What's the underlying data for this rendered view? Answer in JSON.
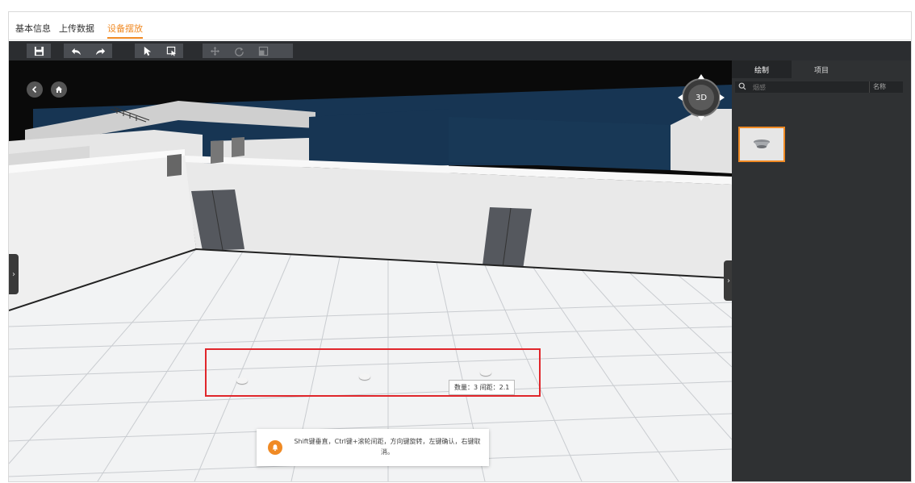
{
  "tabs": [
    {
      "label": "基本信息",
      "active": false
    },
    {
      "label": "上传数据",
      "active": false
    },
    {
      "label": "设备摆放",
      "active": true
    }
  ],
  "toolbar": {
    "buttons": [
      "save-icon",
      "undo-icon",
      "redo-icon",
      "pointer-icon",
      "box-select-icon",
      "move-icon",
      "rotate-icon",
      "scale-icon"
    ],
    "disabled": [
      "move-icon",
      "rotate-icon",
      "scale-icon"
    ]
  },
  "viewport": {
    "nav_label": "3D",
    "selection_info": "数量：3 间距：2.1",
    "hint_text": "Shift键垂直，Ctrl键+滚轮间距，方向键旋转，左键确认，右键取消。"
  },
  "panel": {
    "tabs": [
      {
        "label": "绘制",
        "active": true
      },
      {
        "label": "项目",
        "active": false
      }
    ],
    "search": {
      "placeholder": "烟感",
      "column_label": "名称"
    },
    "items": [
      {
        "name": "smoke-detector-icon",
        "selected": true
      }
    ]
  },
  "colors": {
    "accent": "#f08a24",
    "selection": "#e0262b",
    "panel_bg": "#2f3133",
    "toolbar_bg": "#2b2d30"
  }
}
